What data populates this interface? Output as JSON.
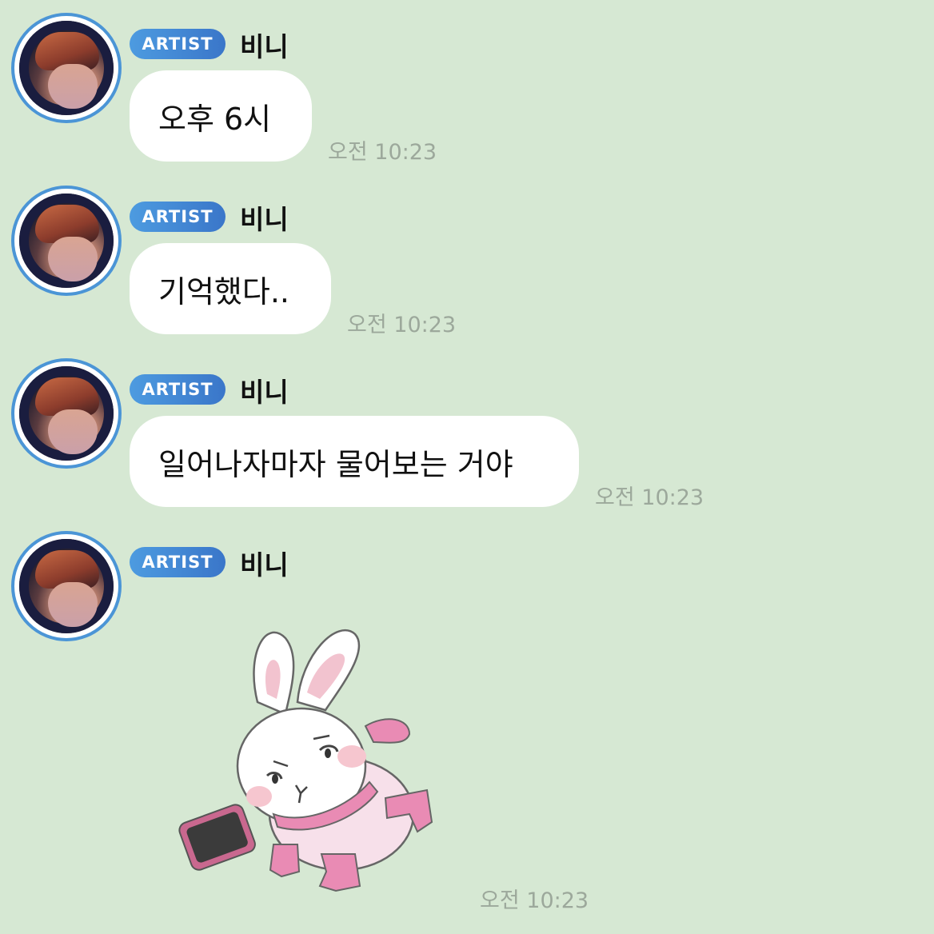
{
  "messages": [
    {
      "badge": "ARTIST",
      "sender": "비니",
      "text": "오후 6시",
      "time": "오전 10:23"
    },
    {
      "badge": "ARTIST",
      "sender": "비니",
      "text": "기억했다..",
      "time": "오전 10:23"
    },
    {
      "badge": "ARTIST",
      "sender": "비니",
      "text": "일어나자마자 물어보는 거야",
      "time": "오전 10:23"
    },
    {
      "badge": "ARTIST",
      "sender": "비니",
      "sticker": "bunny-running-phone-sticker",
      "time": "오전 10:23"
    }
  ],
  "colors": {
    "background": "#d6e8d3",
    "badge": "#4b95d6",
    "bubble": "#ffffff",
    "timestamp": "#9ca89b"
  }
}
